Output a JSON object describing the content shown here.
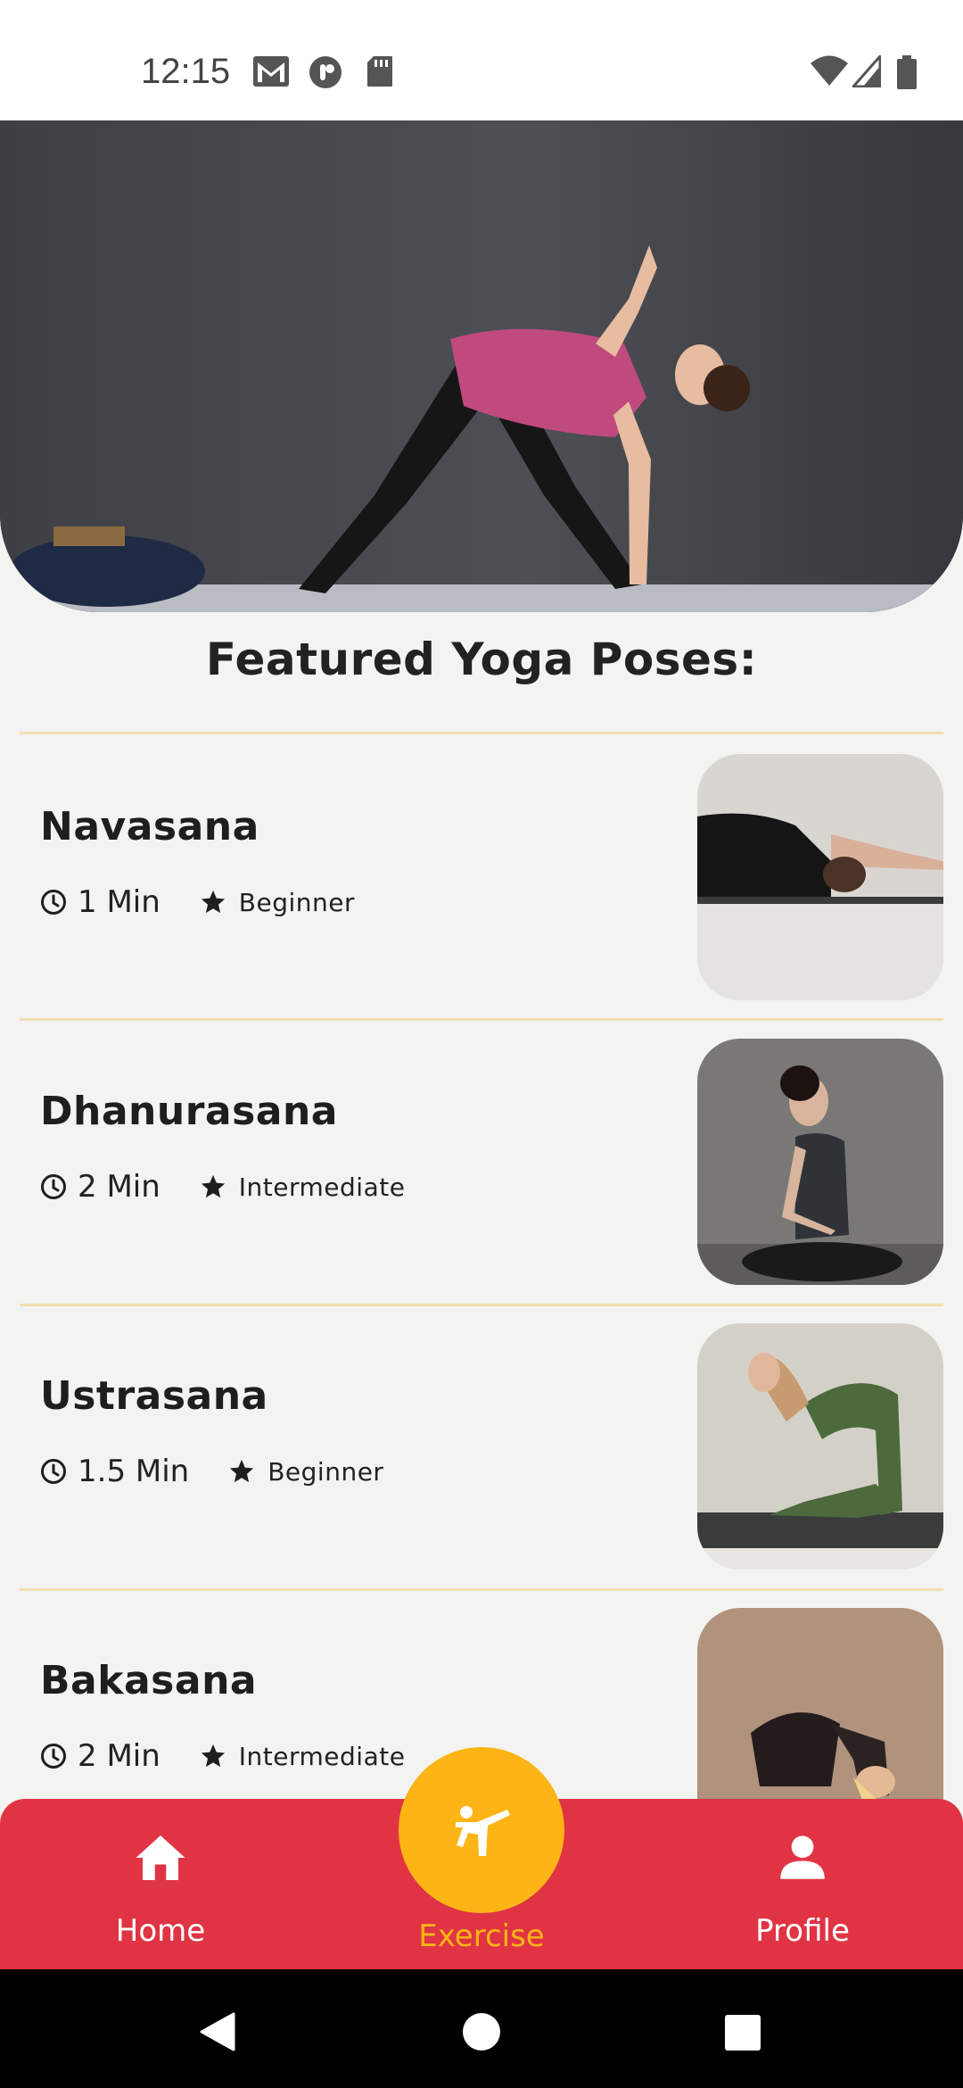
{
  "status_bar": {
    "time": "12:15",
    "left_icons": [
      "gmail-icon",
      "app-icon",
      "sd-card-icon"
    ],
    "right_icons": [
      "wifi-icon",
      "signal-icon",
      "battery-icon"
    ]
  },
  "hero": {
    "image": "woman-doing-triangle-pose-photo"
  },
  "section_title": "Featured Yoga Poses:",
  "poses": [
    {
      "name": "Navasana",
      "duration": "1 Min",
      "level": "Beginner",
      "image": "child-pose-photo"
    },
    {
      "name": "Dhanurasana",
      "duration": "2 Min",
      "level": "Intermediate",
      "image": "seated-meditation-photo"
    },
    {
      "name": "Ustrasana",
      "duration": "1.5 Min",
      "level": "Beginner",
      "image": "camel-pose-photo"
    },
    {
      "name": "Bakasana",
      "duration": "2 Min",
      "level": "Intermediate",
      "image": "crow-pose-photo"
    }
  ],
  "bottom_nav": {
    "items": [
      {
        "label": "Home",
        "icon": "home-icon"
      },
      {
        "label": "Exercise",
        "icon": "exercise-icon",
        "active": true
      },
      {
        "label": "Profile",
        "icon": "profile-icon"
      }
    ]
  },
  "colors": {
    "accent_red": "#e03444",
    "accent_yellow": "#fcb514",
    "divider": "#f2deb0",
    "background": "#f3f3f1"
  },
  "system_nav": {
    "buttons": [
      "back-icon",
      "home-circle-icon",
      "recents-icon"
    ]
  }
}
